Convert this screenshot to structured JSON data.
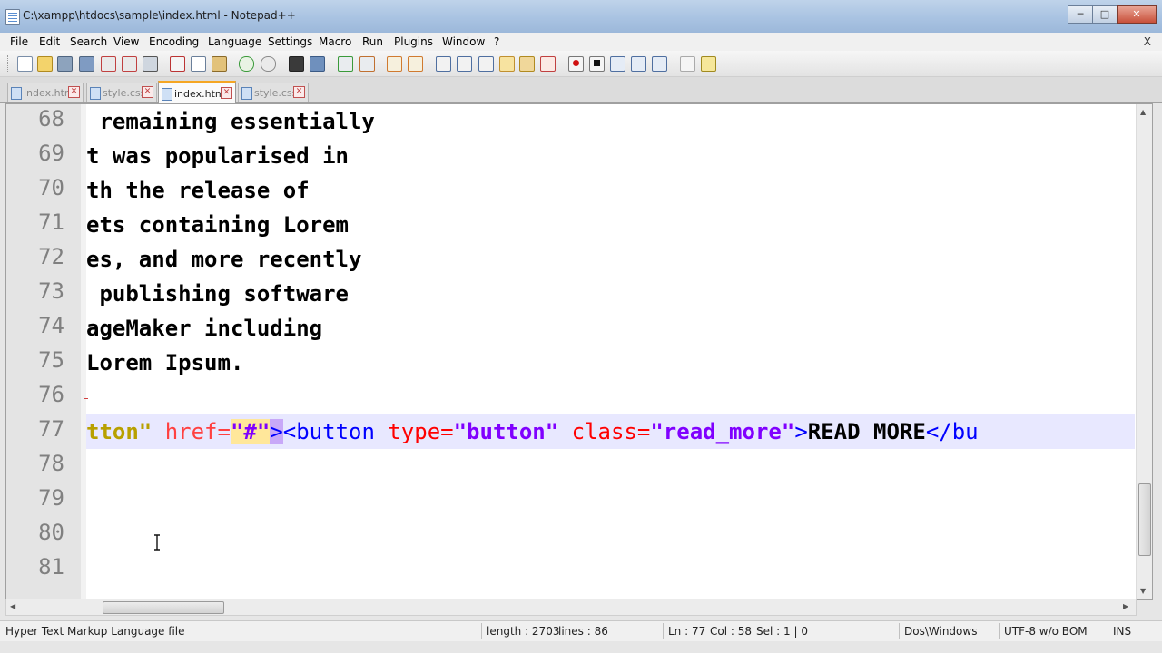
{
  "window": {
    "title": "C:\\xampp\\htdocs\\sample\\index.html - Notepad++",
    "minimize": "─",
    "maximize": "□",
    "close": "✕"
  },
  "menu": {
    "items": [
      "File",
      "Edit",
      "Search",
      "View",
      "Encoding",
      "Language",
      "Settings",
      "Macro",
      "Run",
      "Plugins",
      "Window",
      "?"
    ],
    "close": "X"
  },
  "tabs": [
    {
      "label": "index.html",
      "active": false
    },
    {
      "label": "style.css",
      "active": false
    },
    {
      "label": "index.html",
      "active": true
    },
    {
      "label": "style.css",
      "active": false
    }
  ],
  "editor": {
    "line_numbers": [
      "68",
      "69",
      "70",
      "71",
      "72",
      "73",
      "74",
      "75",
      "76",
      "77",
      "78",
      "79",
      "80",
      "81"
    ],
    "lines": [
      " remaining essentially",
      "t was popularised in",
      "th the release of",
      "ets containing Lorem",
      "es, and more recently",
      " publishing software",
      "ageMaker including",
      "Lorem Ipsum.",
      "",
      "",
      "",
      "",
      "",
      ""
    ],
    "line77": {
      "p1": "tton\" ",
      "p2": "href=",
      "p3": "\"#\"",
      "p4": ">",
      "p5": "<button ",
      "p6": "type=",
      "p7": "\"button\"",
      "p8": " class=",
      "p9": "\"read_more\"",
      "p10": ">",
      "p11": "READ MORE",
      "p12": "</bu"
    }
  },
  "statusbar": {
    "filetype": "Hyper Text Markup Language file",
    "length": "length : 2703",
    "lines": "lines : 86",
    "ln": "Ln : 77",
    "col": "Col : 58",
    "sel": "Sel : 1 | 0",
    "eol": "Dos\\Windows",
    "encoding": "UTF-8 w/o BOM",
    "mode": "INS"
  }
}
